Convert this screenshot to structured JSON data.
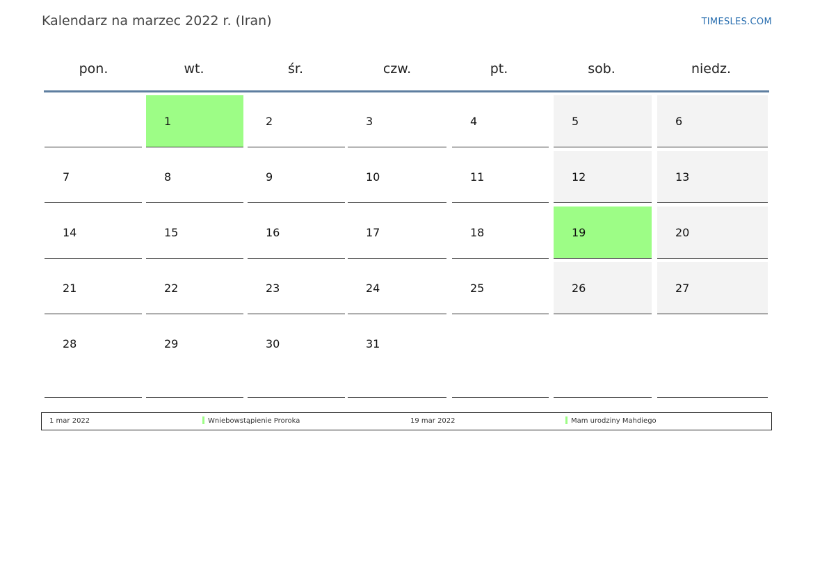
{
  "title": "Kalendarz na marzec 2022 r. (Iran)",
  "brand": "TIMESLES.COM",
  "colors": {
    "holiday": "#9dfd86",
    "weekend": "#f3f3f3",
    "header_rule": "#5e7ea0",
    "brand": "#2a6fb0"
  },
  "weekdays": [
    "pon.",
    "wt.",
    "śr.",
    "czw.",
    "pt.",
    "sob.",
    "niedz."
  ],
  "weeks": [
    [
      "",
      "1",
      "2",
      "3",
      "4",
      "5",
      "6"
    ],
    [
      "7",
      "8",
      "9",
      "10",
      "11",
      "12",
      "13"
    ],
    [
      "14",
      "15",
      "16",
      "17",
      "18",
      "19",
      "20"
    ],
    [
      "21",
      "22",
      "23",
      "24",
      "25",
      "26",
      "27"
    ],
    [
      "28",
      "29",
      "30",
      "31",
      "",
      "",
      ""
    ]
  ],
  "holidays": [
    "1",
    "19"
  ],
  "legend": [
    {
      "date": "1 mar 2022",
      "name": "Wniebowstąpienie Proroka"
    },
    {
      "date": "19 mar 2022",
      "name": "Mam urodziny Mahdiego"
    }
  ]
}
